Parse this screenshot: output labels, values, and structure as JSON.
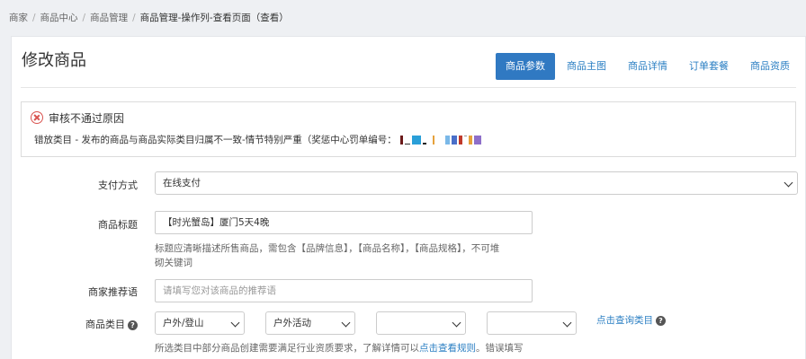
{
  "breadcrumb": [
    "商家",
    "商品中心",
    "商品管理",
    "商品管理-操作列-查看页面（查看）"
  ],
  "page": {
    "title": "修改商品"
  },
  "tabs": [
    {
      "label": "商品参数",
      "active": true
    },
    {
      "label": "商品主图",
      "active": false
    },
    {
      "label": "商品详情",
      "active": false
    },
    {
      "label": "订单套餐",
      "active": false
    },
    {
      "label": "商品资质",
      "active": false
    }
  ],
  "alert": {
    "title": "审核不通过原因",
    "message": "错放类目 - 发布的商品与商品实际类目归属不一致-情节特别严重（奖惩中心罚单编号："
  },
  "form": {
    "payment": {
      "label": "支付方式",
      "value": "在线支付"
    },
    "product_title": {
      "label": "商品标题",
      "value": "【时光蟹岛】厦门5天4晚",
      "hint_line1": "标题应清晰描述所售商品，需包含【品牌信息】，【商品名称】，【商品规格】，不可堆",
      "hint_line2": "砌关键词"
    },
    "recommend": {
      "label": "商家推荐语",
      "placeholder": "请填写您对该商品的推荐语"
    },
    "category": {
      "label": "商品类目",
      "level1": "户外/登山",
      "level2": "户外活动",
      "level3": "",
      "level4": "",
      "query_link": "点击查询类目",
      "hint_text": "所选类目中部分商品创建需要满足行业资质要求，了解详情可以",
      "hint_link": "点击查看规则",
      "hint_tail": "。错误填写"
    }
  },
  "colors": {
    "accent": "#3079c2",
    "link": "#2b7fc3",
    "error": "#d9534f"
  }
}
